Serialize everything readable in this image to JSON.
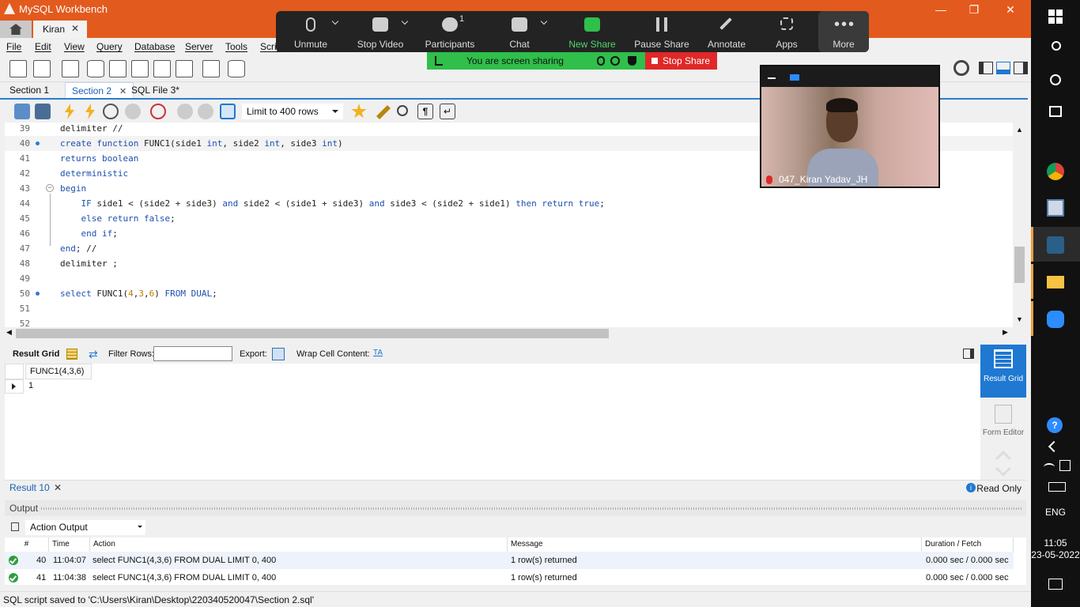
{
  "window": {
    "title": "MySQL Workbench",
    "connection_tab": "Kiran"
  },
  "menu": [
    "File",
    "Edit",
    "View",
    "Query",
    "Database",
    "Server",
    "Tools",
    "Scrip"
  ],
  "section_tabs": [
    {
      "label": "Section 1",
      "active": false
    },
    {
      "label": "Section 2",
      "active": true
    },
    {
      "label": "SQL File 3*",
      "active": false
    }
  ],
  "sql_toolbar": {
    "limit_label": "Limit to 400 rows"
  },
  "editor": {
    "lines": [
      {
        "num": "39",
        "marker": false,
        "fold": false,
        "text": "delimiter //"
      },
      {
        "num": "40",
        "marker": true,
        "fold": false,
        "text": "create function FUNC1(side1 int, side2 int, side3 int)"
      },
      {
        "num": "41",
        "marker": false,
        "fold": false,
        "text": "returns boolean"
      },
      {
        "num": "42",
        "marker": false,
        "fold": false,
        "text": "deterministic"
      },
      {
        "num": "43",
        "marker": false,
        "fold": true,
        "text": "begin"
      },
      {
        "num": "44",
        "marker": false,
        "fold": false,
        "text": "    IF side1 < (side2 + side3) and side2 < (side1 + side3) and side3 < (side2 + side1) then return true;"
      },
      {
        "num": "45",
        "marker": false,
        "fold": false,
        "text": "    else return false;"
      },
      {
        "num": "46",
        "marker": false,
        "fold": false,
        "text": "    end if;"
      },
      {
        "num": "47",
        "marker": false,
        "fold": false,
        "text": "end; //"
      },
      {
        "num": "48",
        "marker": false,
        "fold": false,
        "text": "delimiter ;"
      },
      {
        "num": "49",
        "marker": false,
        "fold": false,
        "text": ""
      },
      {
        "num": "50",
        "marker": true,
        "fold": false,
        "text": "select FUNC1(4,3,6) FROM DUAL;"
      },
      {
        "num": "51",
        "marker": false,
        "fold": false,
        "text": ""
      },
      {
        "num": "52",
        "marker": false,
        "fold": false,
        "text": ""
      }
    ]
  },
  "result_toolbar": {
    "result_grid": "Result Grid",
    "filter_rows": "Filter Rows:",
    "export": "Export:",
    "wrap": "Wrap Cell Content:"
  },
  "result_grid": {
    "column": "FUNC1(4,3,6)",
    "value": "1"
  },
  "side_panel": {
    "result_grid": "Result Grid",
    "form_editor": "Form Editor"
  },
  "result_tab": {
    "label": "Result 10",
    "status": "Read Only"
  },
  "output": {
    "title": "Output",
    "selector": "Action Output",
    "columns": [
      "#",
      "Time",
      "Action",
      "Message",
      "Duration / Fetch"
    ],
    "rows": [
      {
        "num": "40",
        "time": "11:04:07",
        "action": "select FUNC1(4,3,6) FROM DUAL LIMIT 0, 400",
        "message": "1 row(s) returned",
        "duration": "0.000 sec / 0.000 sec"
      },
      {
        "num": "41",
        "time": "11:04:38",
        "action": "select FUNC1(4,3,6) FROM DUAL LIMIT 0, 400",
        "message": "1 row(s) returned",
        "duration": "0.000 sec / 0.000 sec"
      }
    ]
  },
  "status_bar": "SQL script saved to 'C:\\Users\\Kiran\\Desktop\\220340520047\\Section 2.sql'",
  "zoom": {
    "buttons": [
      "Unmute",
      "Stop Video",
      "Participants",
      "Chat",
      "New Share",
      "Pause Share",
      "Annotate",
      "Apps",
      "More"
    ],
    "participants_count": "1",
    "sharing_text": "You are screen sharing",
    "stop_share": "Stop Share",
    "video_name": "047_Kiran Yadav_JH"
  },
  "taskbar": {
    "lang": "ENG",
    "time": "11:05",
    "date": "23-05-2022"
  },
  "colors": {
    "titlebar": "#e35a1e",
    "accent": "#1f78d1",
    "zoom_green": "#2fbf4a",
    "zoom_red": "#e02828"
  }
}
